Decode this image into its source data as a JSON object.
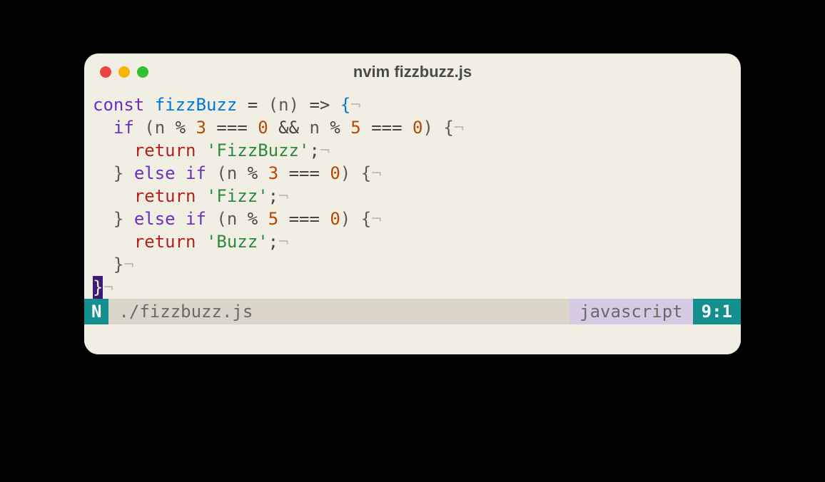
{
  "window": {
    "title": "nvim fizzbuzz.js"
  },
  "traffic": {
    "close": "close",
    "minimize": "minimize",
    "zoom": "zoom"
  },
  "code": {
    "lines": [
      {
        "indent": "",
        "tokens": [
          {
            "t": "const ",
            "c": "kw"
          },
          {
            "t": "fizzBuzz",
            "c": "fn"
          },
          {
            "t": " ",
            "c": "op"
          },
          {
            "t": "=",
            "c": "op"
          },
          {
            "t": " (",
            "c": "par"
          },
          {
            "t": "n",
            "c": "par"
          },
          {
            "t": ") ",
            "c": "par"
          },
          {
            "t": "=>",
            "c": "op"
          },
          {
            "t": " ",
            "c": "op"
          },
          {
            "t": "{",
            "c": "fn"
          },
          {
            "t": "¬",
            "c": "invis"
          }
        ]
      },
      {
        "indent": "  ",
        "tokens": [
          {
            "t": "if",
            "c": "kw"
          },
          {
            "t": " (",
            "c": "par"
          },
          {
            "t": "n",
            "c": "par"
          },
          {
            "t": " % ",
            "c": "op"
          },
          {
            "t": "3",
            "c": "num"
          },
          {
            "t": " === ",
            "c": "op"
          },
          {
            "t": "0",
            "c": "num"
          },
          {
            "t": " && ",
            "c": "op"
          },
          {
            "t": "n",
            "c": "par"
          },
          {
            "t": " % ",
            "c": "op"
          },
          {
            "t": "5",
            "c": "num"
          },
          {
            "t": " === ",
            "c": "op"
          },
          {
            "t": "0",
            "c": "num"
          },
          {
            "t": ") ",
            "c": "par"
          },
          {
            "t": "{",
            "c": "par"
          },
          {
            "t": "¬",
            "c": "invis"
          }
        ]
      },
      {
        "indent": "    ",
        "tokens": [
          {
            "t": "return",
            "c": "ret"
          },
          {
            "t": " ",
            "c": "op"
          },
          {
            "t": "'FizzBuzz'",
            "c": "str"
          },
          {
            "t": ";",
            "c": "op"
          },
          {
            "t": "¬",
            "c": "invis"
          }
        ]
      },
      {
        "indent": "  ",
        "tokens": [
          {
            "t": "} ",
            "c": "par"
          },
          {
            "t": "else if",
            "c": "kw"
          },
          {
            "t": " (",
            "c": "par"
          },
          {
            "t": "n",
            "c": "par"
          },
          {
            "t": " % ",
            "c": "op"
          },
          {
            "t": "3",
            "c": "num"
          },
          {
            "t": " === ",
            "c": "op"
          },
          {
            "t": "0",
            "c": "num"
          },
          {
            "t": ") ",
            "c": "par"
          },
          {
            "t": "{",
            "c": "par"
          },
          {
            "t": "¬",
            "c": "invis"
          }
        ]
      },
      {
        "indent": "    ",
        "tokens": [
          {
            "t": "return",
            "c": "ret"
          },
          {
            "t": " ",
            "c": "op"
          },
          {
            "t": "'Fizz'",
            "c": "str"
          },
          {
            "t": ";",
            "c": "op"
          },
          {
            "t": "¬",
            "c": "invis"
          }
        ]
      },
      {
        "indent": "  ",
        "tokens": [
          {
            "t": "} ",
            "c": "par"
          },
          {
            "t": "else if",
            "c": "kw"
          },
          {
            "t": " (",
            "c": "par"
          },
          {
            "t": "n",
            "c": "par"
          },
          {
            "t": " % ",
            "c": "op"
          },
          {
            "t": "5",
            "c": "num"
          },
          {
            "t": " === ",
            "c": "op"
          },
          {
            "t": "0",
            "c": "num"
          },
          {
            "t": ") ",
            "c": "par"
          },
          {
            "t": "{",
            "c": "par"
          },
          {
            "t": "¬",
            "c": "invis"
          }
        ]
      },
      {
        "indent": "    ",
        "tokens": [
          {
            "t": "return",
            "c": "ret"
          },
          {
            "t": " ",
            "c": "op"
          },
          {
            "t": "'Buzz'",
            "c": "str"
          },
          {
            "t": ";",
            "c": "op"
          },
          {
            "t": "¬",
            "c": "invis"
          }
        ]
      },
      {
        "indent": "  ",
        "tokens": [
          {
            "t": "}",
            "c": "par"
          },
          {
            "t": "¬",
            "c": "invis"
          }
        ]
      },
      {
        "indent": "",
        "tokens": [
          {
            "t": "}",
            "c": "cursor"
          },
          {
            "t": "¬",
            "c": "invis"
          }
        ]
      }
    ]
  },
  "status": {
    "mode": "N",
    "file": "./fizzbuzz.js",
    "filetype": "javascript",
    "position": "9:1"
  },
  "colors": {
    "bg": "#f1eee3",
    "accent": "#138f8f",
    "kw": "#6b2fbf",
    "fn": "#0077dd",
    "ret": "#b02222",
    "str": "#2b8a3e",
    "num": "#b84a00"
  }
}
